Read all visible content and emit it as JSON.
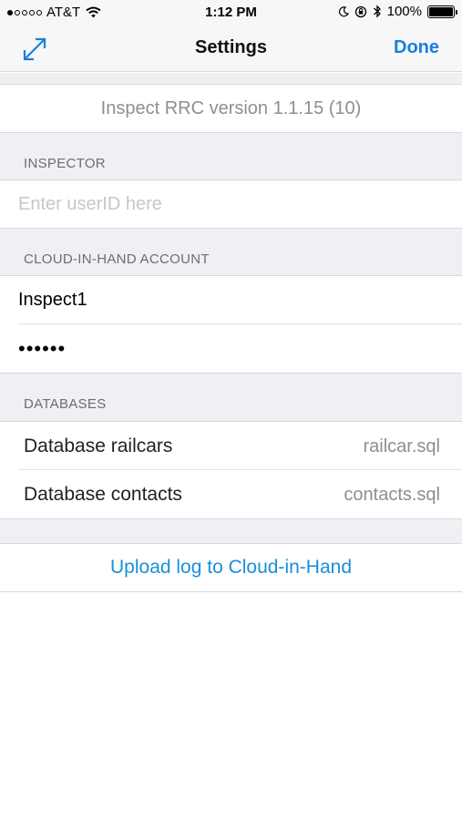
{
  "status_bar": {
    "carrier": "AT&T",
    "time": "1:12 PM",
    "battery": "100%"
  },
  "nav": {
    "title": "Settings",
    "done_label": "Done",
    "left_icon": "expand-arrows-icon"
  },
  "version_text": "Inspect RRC version 1.1.15 (10)",
  "inspector": {
    "header": "INSPECTOR",
    "userid_placeholder": "Enter userID here",
    "userid_value": ""
  },
  "account": {
    "header": "CLOUD-IN-HAND ACCOUNT",
    "username": "Inspect1",
    "password": "••••••"
  },
  "databases": {
    "header": "DATABASES",
    "rows": [
      {
        "label": "Database railcars",
        "value": "railcar.sql"
      },
      {
        "label": "Database contacts",
        "value": "contacts.sql"
      }
    ]
  },
  "upload_label": "Upload log to Cloud-in-Hand",
  "colors": {
    "accent": "#1a7fe0",
    "group_background": "#efeff4",
    "secondary_text": "#8e8e93"
  }
}
